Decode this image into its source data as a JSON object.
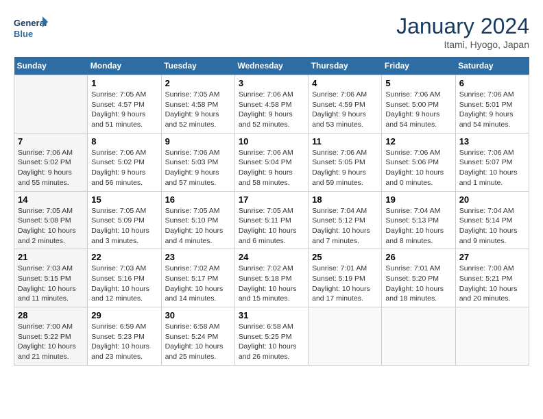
{
  "header": {
    "logo_text_general": "General",
    "logo_text_blue": "Blue",
    "title": "January 2024",
    "subtitle": "Itami, Hyogo, Japan"
  },
  "days_of_week": [
    "Sunday",
    "Monday",
    "Tuesday",
    "Wednesday",
    "Thursday",
    "Friday",
    "Saturday"
  ],
  "weeks": [
    {
      "days": [
        {
          "number": "",
          "sunrise": "",
          "sunset": "",
          "daylight": "",
          "empty": true
        },
        {
          "number": "1",
          "sunrise": "Sunrise: 7:05 AM",
          "sunset": "Sunset: 4:57 PM",
          "daylight": "Daylight: 9 hours and 51 minutes."
        },
        {
          "number": "2",
          "sunrise": "Sunrise: 7:05 AM",
          "sunset": "Sunset: 4:58 PM",
          "daylight": "Daylight: 9 hours and 52 minutes."
        },
        {
          "number": "3",
          "sunrise": "Sunrise: 7:06 AM",
          "sunset": "Sunset: 4:58 PM",
          "daylight": "Daylight: 9 hours and 52 minutes."
        },
        {
          "number": "4",
          "sunrise": "Sunrise: 7:06 AM",
          "sunset": "Sunset: 4:59 PM",
          "daylight": "Daylight: 9 hours and 53 minutes."
        },
        {
          "number": "5",
          "sunrise": "Sunrise: 7:06 AM",
          "sunset": "Sunset: 5:00 PM",
          "daylight": "Daylight: 9 hours and 54 minutes."
        },
        {
          "number": "6",
          "sunrise": "Sunrise: 7:06 AM",
          "sunset": "Sunset: 5:01 PM",
          "daylight": "Daylight: 9 hours and 54 minutes."
        }
      ]
    },
    {
      "days": [
        {
          "number": "7",
          "sunrise": "Sunrise: 7:06 AM",
          "sunset": "Sunset: 5:02 PM",
          "daylight": "Daylight: 9 hours and 55 minutes."
        },
        {
          "number": "8",
          "sunrise": "Sunrise: 7:06 AM",
          "sunset": "Sunset: 5:02 PM",
          "daylight": "Daylight: 9 hours and 56 minutes."
        },
        {
          "number": "9",
          "sunrise": "Sunrise: 7:06 AM",
          "sunset": "Sunset: 5:03 PM",
          "daylight": "Daylight: 9 hours and 57 minutes."
        },
        {
          "number": "10",
          "sunrise": "Sunrise: 7:06 AM",
          "sunset": "Sunset: 5:04 PM",
          "daylight": "Daylight: 9 hours and 58 minutes."
        },
        {
          "number": "11",
          "sunrise": "Sunrise: 7:06 AM",
          "sunset": "Sunset: 5:05 PM",
          "daylight": "Daylight: 9 hours and 59 minutes."
        },
        {
          "number": "12",
          "sunrise": "Sunrise: 7:06 AM",
          "sunset": "Sunset: 5:06 PM",
          "daylight": "Daylight: 10 hours and 0 minutes."
        },
        {
          "number": "13",
          "sunrise": "Sunrise: 7:06 AM",
          "sunset": "Sunset: 5:07 PM",
          "daylight": "Daylight: 10 hours and 1 minute."
        }
      ]
    },
    {
      "days": [
        {
          "number": "14",
          "sunrise": "Sunrise: 7:05 AM",
          "sunset": "Sunset: 5:08 PM",
          "daylight": "Daylight: 10 hours and 2 minutes."
        },
        {
          "number": "15",
          "sunrise": "Sunrise: 7:05 AM",
          "sunset": "Sunset: 5:09 PM",
          "daylight": "Daylight: 10 hours and 3 minutes."
        },
        {
          "number": "16",
          "sunrise": "Sunrise: 7:05 AM",
          "sunset": "Sunset: 5:10 PM",
          "daylight": "Daylight: 10 hours and 4 minutes."
        },
        {
          "number": "17",
          "sunrise": "Sunrise: 7:05 AM",
          "sunset": "Sunset: 5:11 PM",
          "daylight": "Daylight: 10 hours and 6 minutes."
        },
        {
          "number": "18",
          "sunrise": "Sunrise: 7:04 AM",
          "sunset": "Sunset: 5:12 PM",
          "daylight": "Daylight: 10 hours and 7 minutes."
        },
        {
          "number": "19",
          "sunrise": "Sunrise: 7:04 AM",
          "sunset": "Sunset: 5:13 PM",
          "daylight": "Daylight: 10 hours and 8 minutes."
        },
        {
          "number": "20",
          "sunrise": "Sunrise: 7:04 AM",
          "sunset": "Sunset: 5:14 PM",
          "daylight": "Daylight: 10 hours and 9 minutes."
        }
      ]
    },
    {
      "days": [
        {
          "number": "21",
          "sunrise": "Sunrise: 7:03 AM",
          "sunset": "Sunset: 5:15 PM",
          "daylight": "Daylight: 10 hours and 11 minutes."
        },
        {
          "number": "22",
          "sunrise": "Sunrise: 7:03 AM",
          "sunset": "Sunset: 5:16 PM",
          "daylight": "Daylight: 10 hours and 12 minutes."
        },
        {
          "number": "23",
          "sunrise": "Sunrise: 7:02 AM",
          "sunset": "Sunset: 5:17 PM",
          "daylight": "Daylight: 10 hours and 14 minutes."
        },
        {
          "number": "24",
          "sunrise": "Sunrise: 7:02 AM",
          "sunset": "Sunset: 5:18 PM",
          "daylight": "Daylight: 10 hours and 15 minutes."
        },
        {
          "number": "25",
          "sunrise": "Sunrise: 7:01 AM",
          "sunset": "Sunset: 5:19 PM",
          "daylight": "Daylight: 10 hours and 17 minutes."
        },
        {
          "number": "26",
          "sunrise": "Sunrise: 7:01 AM",
          "sunset": "Sunset: 5:20 PM",
          "daylight": "Daylight: 10 hours and 18 minutes."
        },
        {
          "number": "27",
          "sunrise": "Sunrise: 7:00 AM",
          "sunset": "Sunset: 5:21 PM",
          "daylight": "Daylight: 10 hours and 20 minutes."
        }
      ]
    },
    {
      "days": [
        {
          "number": "28",
          "sunrise": "Sunrise: 7:00 AM",
          "sunset": "Sunset: 5:22 PM",
          "daylight": "Daylight: 10 hours and 21 minutes."
        },
        {
          "number": "29",
          "sunrise": "Sunrise: 6:59 AM",
          "sunset": "Sunset: 5:23 PM",
          "daylight": "Daylight: 10 hours and 23 minutes."
        },
        {
          "number": "30",
          "sunrise": "Sunrise: 6:58 AM",
          "sunset": "Sunset: 5:24 PM",
          "daylight": "Daylight: 10 hours and 25 minutes."
        },
        {
          "number": "31",
          "sunrise": "Sunrise: 6:58 AM",
          "sunset": "Sunset: 5:25 PM",
          "daylight": "Daylight: 10 hours and 26 minutes."
        },
        {
          "number": "",
          "sunrise": "",
          "sunset": "",
          "daylight": "",
          "empty": true
        },
        {
          "number": "",
          "sunrise": "",
          "sunset": "",
          "daylight": "",
          "empty": true
        },
        {
          "number": "",
          "sunrise": "",
          "sunset": "",
          "daylight": "",
          "empty": true
        }
      ]
    }
  ]
}
